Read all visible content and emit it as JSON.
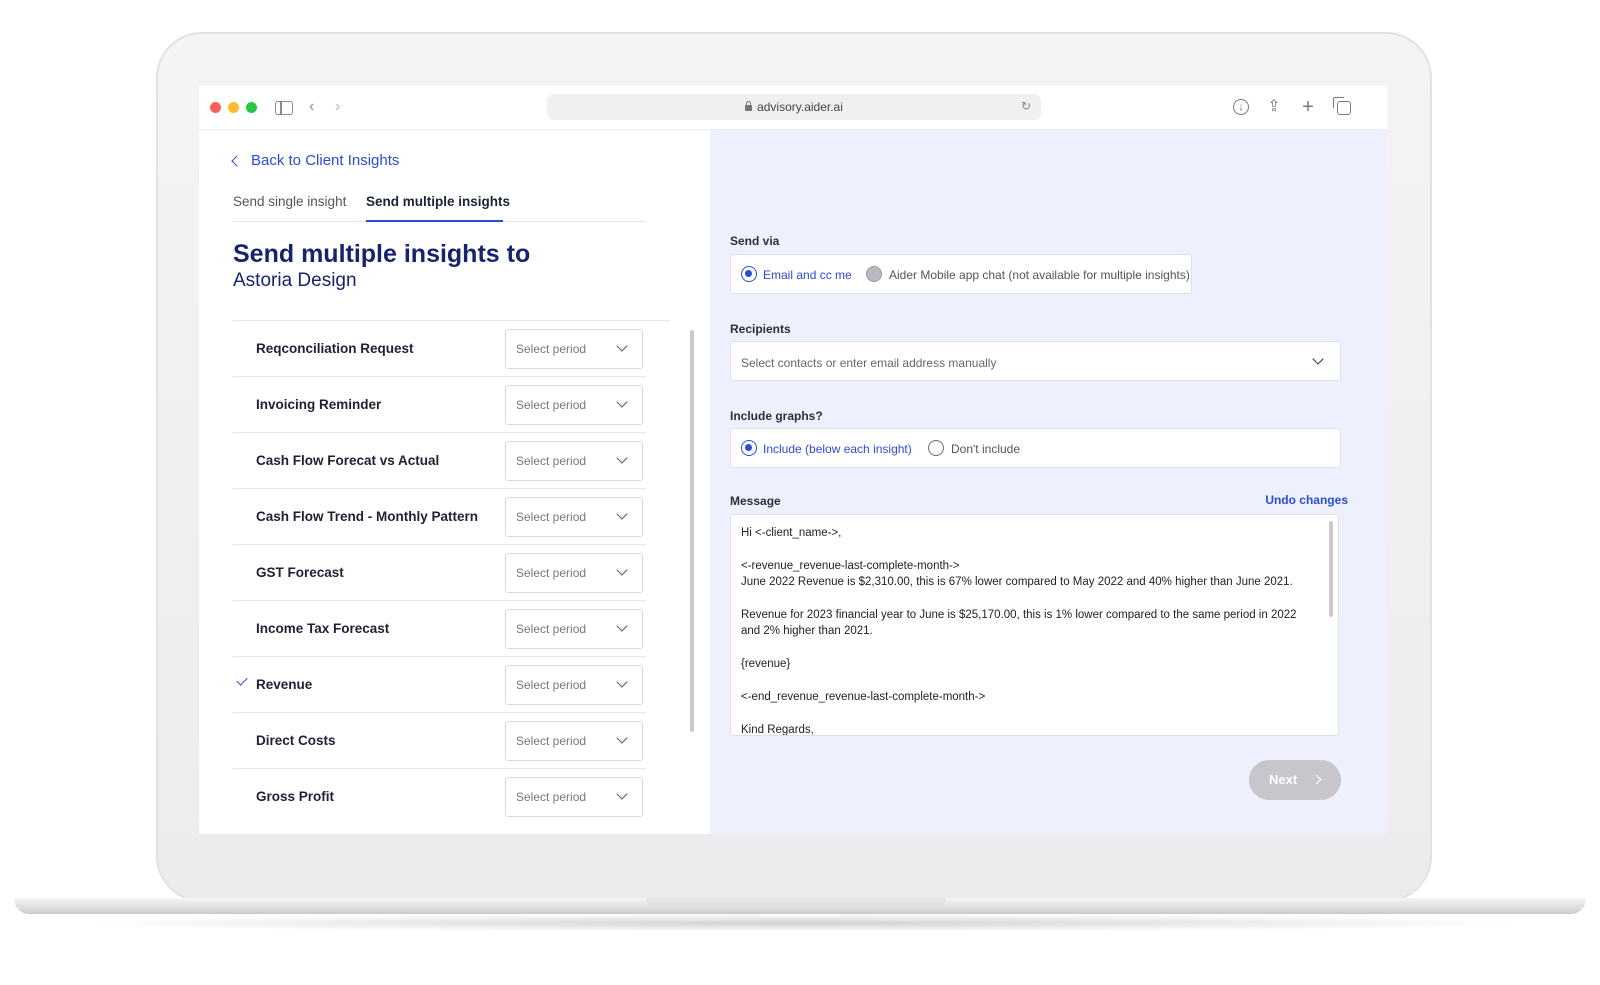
{
  "browser": {
    "url": "advisory.aider.ai"
  },
  "left": {
    "back_label": "Back to Client Insights",
    "tabs": [
      {
        "label": "Send single insight"
      },
      {
        "label": "Send multiple insights"
      }
    ],
    "title": "Send multiple insights to",
    "client_name": "Astoria Design",
    "select_placeholder": "Select period",
    "insights": [
      {
        "label": "Reqconciliation Request",
        "checked": false
      },
      {
        "label": "Invoicing Reminder",
        "checked": false
      },
      {
        "label": "Cash Flow Forecat vs Actual",
        "checked": false
      },
      {
        "label": "Cash Flow Trend - Monthly Pattern",
        "checked": false
      },
      {
        "label": "GST Forecast",
        "checked": false
      },
      {
        "label": "Income Tax Forecast",
        "checked": false
      },
      {
        "label": "Revenue",
        "checked": true
      },
      {
        "label": "Direct Costs",
        "checked": false
      },
      {
        "label": "Gross Profit",
        "checked": false
      }
    ]
  },
  "right": {
    "send_via_label": "Send via",
    "send_via_options": [
      {
        "label": "Email and cc me",
        "selected": true
      },
      {
        "label": "Aider Mobile app chat (not available for multiple insights)",
        "selected": false
      }
    ],
    "recipients_label": "Recipients",
    "recipients_placeholder": "Select contacts or enter email address manually",
    "graphs_label": "Include graphs?",
    "graph_options": [
      {
        "label": "Include (below each insight)",
        "selected": true
      },
      {
        "label": "Don't include",
        "selected": false
      }
    ],
    "message_label": "Message",
    "undo_label": "Undo changes",
    "message_lines": [
      "Hi <-client_name->,",
      "",
      "<-revenue_revenue-last-complete-month->",
      "June 2022 Revenue is $2,310.00, this is 67% lower compared to May 2022 and 40% higher than June 2021.",
      "",
      "Revenue for 2023 financial year to June is $25,170.00, this is 1% lower compared to the same period in 2022",
      "and 2% higher than 2021.",
      "",
      " {revenue}",
      "",
      "<-end_revenue_revenue-last-complete-month->",
      "",
      "Kind Regards,"
    ],
    "next_label": "Next"
  },
  "colors": {
    "accent": "#2c4bd6",
    "title": "#16246b",
    "right_bg": "#eef1fd",
    "next_disabled": "#c6c6cc"
  }
}
